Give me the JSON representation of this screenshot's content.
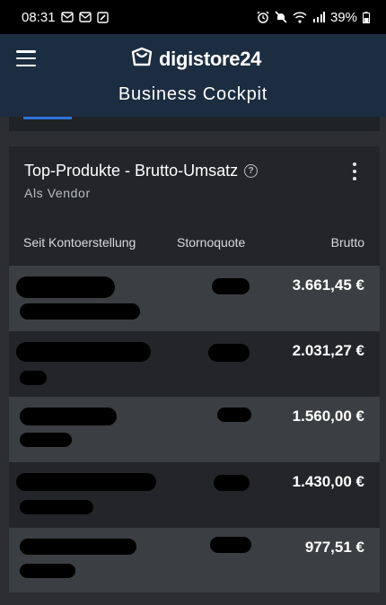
{
  "status_bar": {
    "time": "08:31",
    "battery": "39%",
    "icons": [
      "mail-icon",
      "mail-icon",
      "edit-icon",
      "alarm-icon",
      "mute-icon",
      "wifi-icon",
      "signal-icon",
      "battery-icon"
    ]
  },
  "header": {
    "logo_text": "digistore24",
    "title": "Business Cockpit"
  },
  "card": {
    "title": "Top-Produkte - Brutto-Umsatz",
    "subtitle": "Als Vendor",
    "columns": [
      "Seit Kontoerstellung",
      "Stornoquote",
      "Brutto"
    ],
    "rows": [
      {
        "brutto": "3.661,45 €",
        "redacted": true
      },
      {
        "brutto": "2.031,27 €",
        "redacted": true
      },
      {
        "brutto": "1.560,00 €",
        "redacted": true
      },
      {
        "brutto": "1.430,00 €",
        "redacted": true
      },
      {
        "brutto": "977,51 €",
        "redacted": true
      }
    ]
  },
  "colors": {
    "header_bg": "#1c2d41",
    "page_bg": "#2c2e31",
    "card_bg": "#232528",
    "row_alt_bg": "#3b3e42",
    "accent": "#2f72d9"
  }
}
